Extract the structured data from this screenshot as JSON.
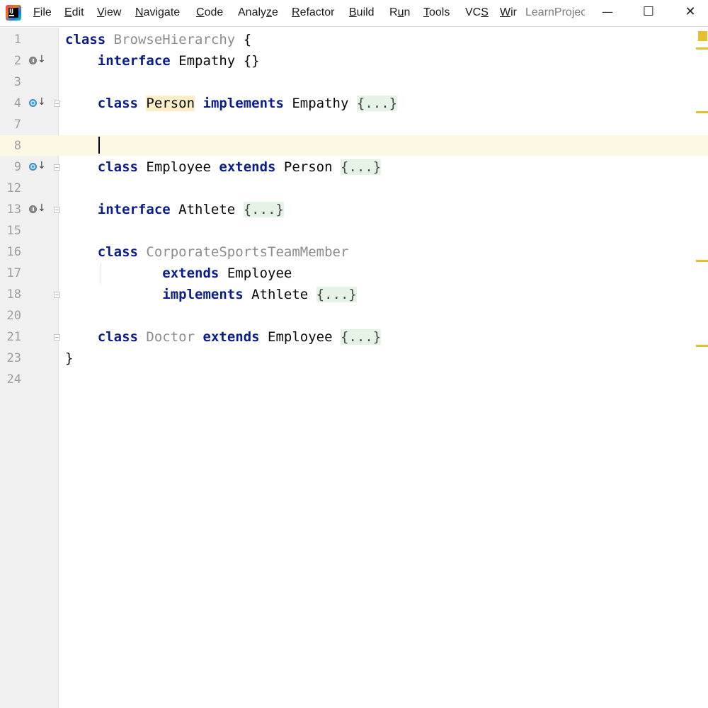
{
  "menubar": {
    "items": [
      {
        "underline": "F",
        "rest": "ile"
      },
      {
        "underline": "E",
        "rest": "dit"
      },
      {
        "underline": "V",
        "rest": "iew"
      },
      {
        "underline": "N",
        "rest": "avigate"
      },
      {
        "underline": "C",
        "rest": "ode"
      },
      {
        "pre": "Analy",
        "underline": "z",
        "rest": "e"
      },
      {
        "underline": "R",
        "rest": "efactor"
      },
      {
        "underline": "B",
        "rest": "uild"
      },
      {
        "pre": "R",
        "underline": "u",
        "rest": "n"
      },
      {
        "underline": "T",
        "rest": "ools"
      },
      {
        "pre": "VC",
        "underline": "S",
        "rest": ""
      },
      {
        "underline": "W",
        "rest": "ir"
      }
    ],
    "project_title": "LearnProject",
    "minimize_glyph": "—",
    "maximize_glyph": "☐",
    "close_glyph": "✕"
  },
  "editor": {
    "line_numbers": [
      "1",
      "2",
      "3",
      "4",
      "7",
      "8",
      "9",
      "12",
      "13",
      "15",
      "16",
      "17",
      "18",
      "20",
      "21",
      "23",
      "24"
    ],
    "lines": {
      "l1": {
        "kw": "class",
        "name": "BrowseHierarchy",
        "brace": "{"
      },
      "l2": {
        "kw": "interface",
        "name": "Empathy",
        "body": "{}"
      },
      "l4": {
        "kw": "class",
        "name": "Person",
        "kw2": "implements",
        "name2": "Empathy",
        "folded": "{...}"
      },
      "l9": {
        "kw": "class",
        "name": "Employee",
        "kw2": "extends",
        "name2": "Person",
        "folded": "{...}"
      },
      "l13": {
        "kw": "interface",
        "name": "Athlete",
        "folded": "{...}"
      },
      "l16": {
        "kw": "class",
        "name": "CorporateSportsTeamMember"
      },
      "l17": {
        "kw": "extends",
        "name": "Employee"
      },
      "l18": {
        "kw": "implements",
        "name": "Athlete",
        "folded": "{...}"
      },
      "l21": {
        "kw": "class",
        "name": "Doctor",
        "kw2": "extends",
        "name2": "Employee",
        "folded": "{...}"
      },
      "l23": {
        "brace": "}"
      }
    }
  },
  "colors": {
    "keyword": "#0b1d8a",
    "unused_identifier": "#8c8c8c",
    "caret_row": "#fdf8e4",
    "identifier_highlight": "#fbeec7",
    "folded_region": "#e5f3e6",
    "warning_stripe": "#e6bf2e"
  },
  "icons": {
    "interface_gutter": "implemented-interface-icon",
    "class_gutter": "subclassed-class-icon",
    "fold": "fold-expand-icon"
  }
}
